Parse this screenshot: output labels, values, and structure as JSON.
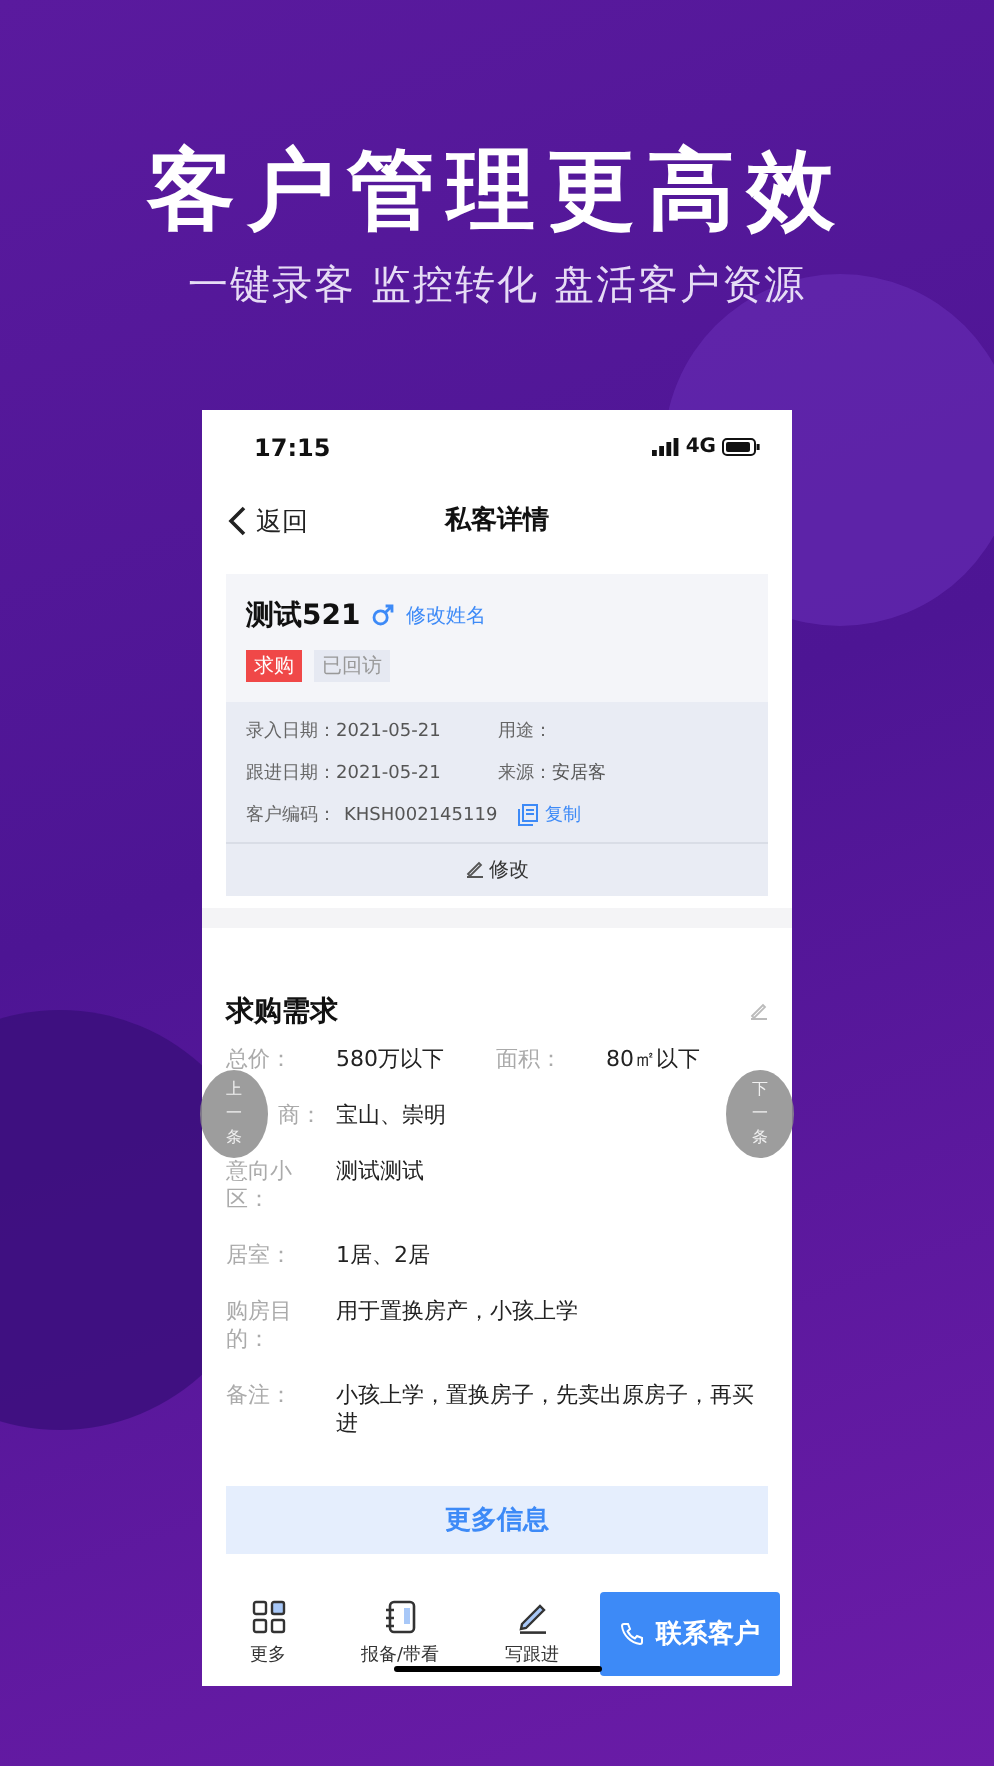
{
  "headline": "客户管理更高效",
  "subheadline": "一键录客 监控转化 盘活客户资源",
  "status_bar": {
    "time": "17:15",
    "network": "4G"
  },
  "nav": {
    "back": "返回",
    "title": "私客详情"
  },
  "customer": {
    "name": "测试521",
    "rename": "修改姓名",
    "tags": [
      {
        "label": "求购",
        "kind": "primary"
      },
      {
        "label": "已回访",
        "kind": "muted"
      }
    ],
    "fields": [
      {
        "label": "录入日期：",
        "value": "2021-05-21"
      },
      {
        "label": "用途："
      },
      {
        "label": "跟进日期：",
        "value": "2021-05-21"
      },
      {
        "label": "来源：",
        "value": "安居客"
      }
    ],
    "code_label": "客户编码：",
    "code": "KHSH002145119",
    "copy": "复制",
    "edit": "修改"
  },
  "requirements": {
    "title": "求购需求",
    "rows": [
      {
        "label": "总价：",
        "value": "580万以下",
        "label_2": "面积：",
        "value_2": "80㎡以下"
      },
      {
        "label": "商：",
        "value": "宝山、崇明"
      },
      {
        "label": "意向小区：",
        "value": "测试测试"
      },
      {
        "label": "居室：",
        "value": "1居、2居"
      },
      {
        "label": "购房目的：",
        "value": "用于置换房产，小孩上学"
      },
      {
        "label": "备注：",
        "value": "小孩上学，置换房子，先卖出原房子，再买进"
      }
    ],
    "more": "更多信息"
  },
  "prev": "上一条",
  "next": "下一条",
  "toolbar": [
    {
      "label": "更多"
    },
    {
      "label": "报备/带看"
    },
    {
      "label": "写跟进"
    }
  ],
  "contact": "联系客户"
}
